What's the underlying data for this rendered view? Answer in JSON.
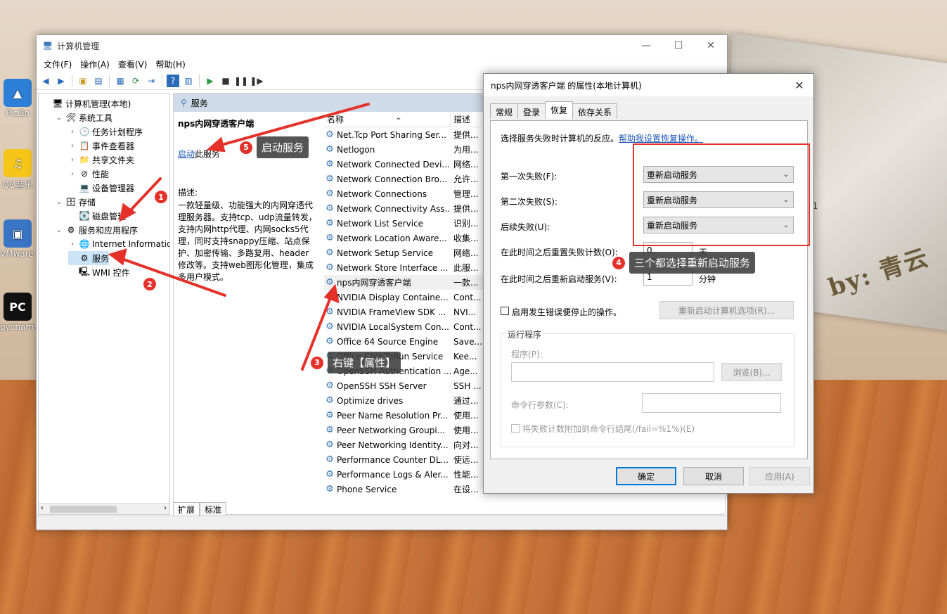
{
  "desktop": {
    "icons": [
      {
        "label": "PicGo",
        "color": "#2d7fd8",
        "glyph": "▲"
      },
      {
        "label": "QQ音乐",
        "color": "#f5c518",
        "glyph": "♫"
      },
      {
        "label": "VMware Workstati...",
        "color": "#3a74c4",
        "glyph": "▣"
      },
      {
        "label": "pycharm",
        "color": "#111111",
        "glyph": "PC"
      }
    ],
    "board_text": "by: 青云",
    "board_letter": "h"
  },
  "main_window": {
    "title": "计算机管理",
    "controls": {
      "minimize": "—",
      "maximize": "☐",
      "close": "✕"
    },
    "menu": [
      "文件(F)",
      "操作(A)",
      "查看(V)",
      "帮助(H)"
    ],
    "tree": [
      {
        "label": "计算机管理(本地)",
        "arrow": "",
        "icon": "🖥",
        "level": 0
      },
      {
        "label": "系统工具",
        "arrow": "⌄",
        "icon": "🛠",
        "level": 1
      },
      {
        "label": "任务计划程序",
        "arrow": "›",
        "icon": "🕒",
        "level": 2
      },
      {
        "label": "事件查看器",
        "arrow": "›",
        "icon": "📋",
        "level": 2
      },
      {
        "label": "共享文件夹",
        "arrow": "›",
        "icon": "📁",
        "level": 2
      },
      {
        "label": "性能",
        "arrow": "›",
        "icon": "⊘",
        "level": 2
      },
      {
        "label": "设备管理器",
        "arrow": "",
        "icon": "💻",
        "level": 2
      },
      {
        "label": "存储",
        "arrow": "⌄",
        "icon": "🗄",
        "level": 1
      },
      {
        "label": "磁盘管理",
        "arrow": "",
        "icon": "💽",
        "level": 2
      },
      {
        "label": "服务和应用程序",
        "arrow": "⌄",
        "icon": "⚙",
        "level": 1
      },
      {
        "label": "Internet Information S",
        "arrow": "›",
        "icon": "🌐",
        "level": 2
      },
      {
        "label": "服务",
        "arrow": "",
        "icon": "⚙",
        "level": 2,
        "selected": true
      },
      {
        "label": "WMI 控件",
        "arrow": "",
        "icon": "🖳",
        "level": 2
      }
    ],
    "services_header": "服务",
    "selected_service": {
      "name": "nps内网穿透客户端",
      "start_link": "启动",
      "start_suffix": "此服务",
      "desc_label": "描述:",
      "desc_text": "一款轻量级、功能强大的内网穿透代理服务器。支持tcp、udp流量转发，支持内网http代理、内网socks5代理，同时支持snappy压缩、站点保护、加密传输、多路复用、header修改等。支持web图形化管理，集成多用户模式。"
    },
    "columns": {
      "name": "名称",
      "desc": "描述"
    },
    "services": [
      {
        "name": "Net.Tcp Port Sharing Ser...",
        "desc": "提供..."
      },
      {
        "name": "Netlogon",
        "desc": "为用..."
      },
      {
        "name": "Network Connected Devi...",
        "desc": "网络..."
      },
      {
        "name": "Network Connection Bro...",
        "desc": "允许..."
      },
      {
        "name": "Network Connections",
        "desc": "管理..."
      },
      {
        "name": "Network Connectivity Ass...",
        "desc": "提供..."
      },
      {
        "name": "Network List Service",
        "desc": "识别..."
      },
      {
        "name": "Network Location Aware...",
        "desc": "收集..."
      },
      {
        "name": "Network Setup Service",
        "desc": "网络..."
      },
      {
        "name": "Network Store Interface ...",
        "desc": "此服..."
      },
      {
        "name": "nps内网穿透客户端",
        "desc": "一款...",
        "highlight": true
      },
      {
        "name": "NVIDIA Display Containe...",
        "desc": "Cont..."
      },
      {
        "name": "NVIDIA FrameView SDK ...",
        "desc": "NVI..."
      },
      {
        "name": "NVIDIA LocalSystem Con...",
        "desc": "Cont..."
      },
      {
        "name": "Office 64 Source Engine",
        "desc": "Save..."
      },
      {
        "name": "Office ClickToRun Service",
        "desc": "Kee..."
      },
      {
        "name": "OpenSSH Authentication ...",
        "desc": "Age..."
      },
      {
        "name": "OpenSSH SSH Server",
        "desc": "SSH ..."
      },
      {
        "name": "Optimize drives",
        "desc": "通过..."
      },
      {
        "name": "Peer Name Resolution Pr...",
        "desc": "使用..."
      },
      {
        "name": "Peer Networking Groupi...",
        "desc": "使用..."
      },
      {
        "name": "Peer Networking Identity...",
        "desc": "向对..."
      },
      {
        "name": "Performance Counter DL...",
        "desc": "使远..."
      },
      {
        "name": "Performance Logs & Aler...",
        "desc": "性能..."
      },
      {
        "name": "Phone Service",
        "desc": "在设..."
      }
    ],
    "bottom_tabs": [
      "扩展",
      "标准"
    ]
  },
  "dialog": {
    "title": "nps内网穿透客户端 的属性(本地计算机)",
    "close": "✕",
    "tabs": [
      "常规",
      "登录",
      "恢复",
      "依存关系"
    ],
    "active_tab": "恢复",
    "intro": "选择服务失败时计算机的反应。",
    "help_link": "帮助我设置恢复操作。",
    "first_failure_label": "第一次失败(F):",
    "first_failure_value": "重新启动服务",
    "second_failure_label": "第二次失败(S):",
    "second_failure_value": "重新启动服务",
    "subsequent_label": "后续失败(U):",
    "subsequent_value": "重新启动服务",
    "reset_label": "在此时间之后重置失败计数(O):",
    "reset_value": "0",
    "reset_unit": "天",
    "restart_label": "在此时间之后重新启动服务(V):",
    "restart_value": "1",
    "restart_unit": "分钟",
    "enable_stop_errors": "启用发生错误便停止的操作。",
    "restart_options_btn": "重新启动计算机选项(R)...",
    "run_program_group": "运行程序",
    "program_label": "程序(P):",
    "browse_btn": "浏览(B)...",
    "cmd_params_label": "命令行参数(C):",
    "append_fail_count": "将失败计数附加到命令行结尾(/fail=%1%)(E)",
    "ok_btn": "确定",
    "cancel_btn": "取消",
    "apply_btn": "应用(A)"
  },
  "annotations": [
    {
      "num": "1",
      "text": ""
    },
    {
      "num": "2",
      "text": ""
    },
    {
      "num": "3",
      "text": "右键【属性】"
    },
    {
      "num": "4",
      "text": "三个都选择重新启动服务"
    },
    {
      "num": "5",
      "text": "启动服务"
    }
  ],
  "colors": {
    "annotation_red": "#e4322b",
    "link_blue": "#1a56b8",
    "selection": "#cce4f7"
  }
}
